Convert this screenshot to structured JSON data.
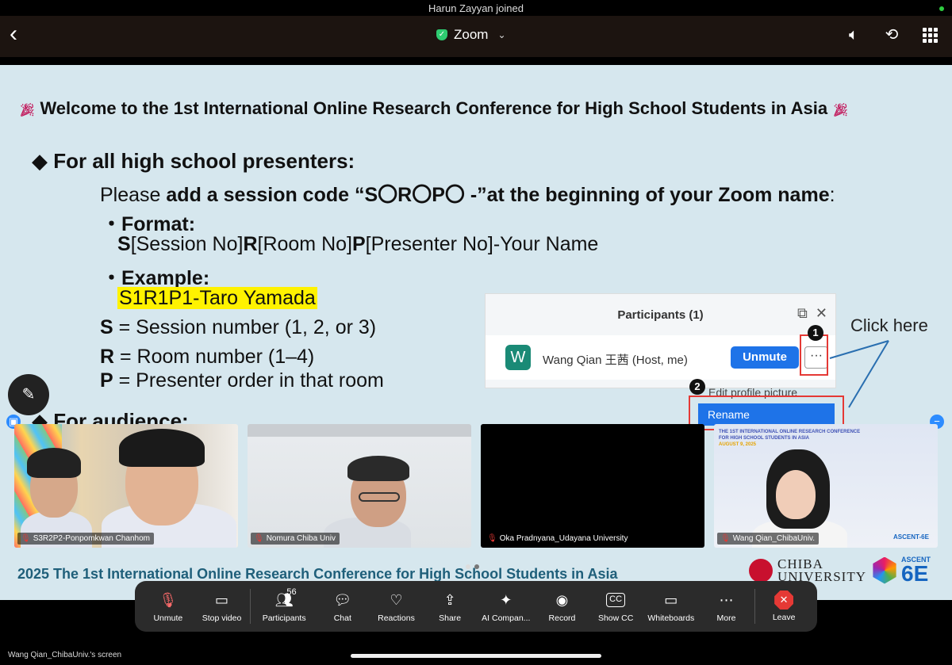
{
  "status": {
    "notification": "Harun Zayyan joined"
  },
  "topbar": {
    "title": "Zoom"
  },
  "slide": {
    "title": "Welcome to the 1st International Online Research Conference for High School Students in Asia",
    "presenters_heading": "For all high school presenters:",
    "instruction_pre": "Please ",
    "instruction_bold": "add a session code “S〇R〇P〇 -”at the beginning of your Zoom name",
    "instruction_post": ":",
    "format_label": "・Format:",
    "format_s": "S",
    "format_session": "[Session No]",
    "format_r": "R",
    "format_room": "[Room No]",
    "format_p": "P",
    "format_presenter": "[Presenter No]-Your Name",
    "example_label": "・Example:",
    "example_value": "S1R1P1-Taro Yamada",
    "s_key": "S",
    "s_desc": " = Session number (1, 2, or 3)",
    "r_key": "R",
    "r_desc": " = Room number (1–4)",
    "p_key": "P",
    "p_desc": " = Presenter order in that room",
    "audience_heading": "For audience:",
    "footer": "2025 The 1st International Online Research Conference for High School Students in Asia",
    "chiba_line1": "CHIBA",
    "chiba_line2": "UNIVERSITY",
    "ascent_small": "ASCENT",
    "ascent_big": "6E",
    "click_here": "Click here",
    "panel": {
      "title": "Participants (1)",
      "avatar_letter": "W",
      "name": "Wang Qian 王茜 (Host, me)",
      "unmute": "Unmute",
      "more": "···",
      "badge1": "1",
      "badge2": "2",
      "menu_edit": "Edit profile picture",
      "menu_rename": "Rename"
    }
  },
  "tiles": [
    {
      "label": "S3R2P2-Ponpomkwan Chanhom"
    },
    {
      "label": "Nomura Chiba Univ"
    },
    {
      "label": "Oka Pradnyana_Udayana University"
    },
    {
      "label": "Wang Qian_ChibaUniv."
    }
  ],
  "tile4_banner": {
    "line1": "THE 1ST INTERNATIONAL ONLINE RESEARCH CONFERENCE",
    "line2": "FOR HIGH SCHOOL STUDENTS IN ASIA",
    "date": "AUGUST 9, 2025",
    "brand": "ASCENT-6E"
  },
  "toolbar": {
    "unmute": "Unmute",
    "stop_video": "Stop video",
    "participants": "Participants",
    "participants_count": "56",
    "chat": "Chat",
    "reactions": "Reactions",
    "share": "Share",
    "ai_companion": "AI Compan...",
    "record": "Record",
    "show_cc": "Show CC",
    "cc_glyph": "CC",
    "whiteboards": "Whiteboards",
    "more": "More",
    "leave": "Leave"
  },
  "screen_label": "Wang Qian_ChibaUniv.'s screen",
  "colors": {
    "accent": "#1e73e8",
    "leave": "#e53935",
    "highlight": "#fff200"
  }
}
